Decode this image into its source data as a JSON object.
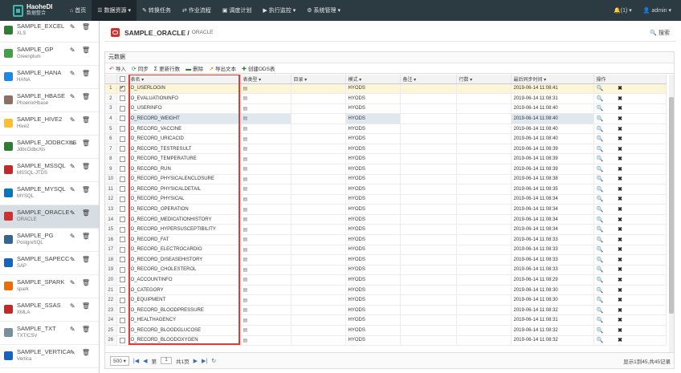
{
  "app": {
    "logo_line1": "HaoheDI",
    "logo_line2": "数据整合"
  },
  "nav": [
    {
      "icon": "⌂",
      "label": "首页"
    },
    {
      "icon": "☰",
      "label": "数据资源 ▾"
    },
    {
      "icon": "✎",
      "label": "转换任务"
    },
    {
      "icon": "⇄",
      "label": "作业流程"
    },
    {
      "icon": "▣",
      "label": "调度计划"
    },
    {
      "icon": "▶",
      "label": "执行监控 ▾"
    },
    {
      "icon": "⚙",
      "label": "系统管理 ▾"
    }
  ],
  "top_right": {
    "notify": "🔔(1) ▾",
    "user": "👤 admin ▾"
  },
  "sidebar": [
    {
      "name": "SAMPLE_EXCEL",
      "sub": "XLS",
      "color": "#2e7d32"
    },
    {
      "name": "SAMPLE_GP",
      "sub": "Greenplum",
      "color": "#43a047"
    },
    {
      "name": "SAMPLE_HANA",
      "sub": "HANA",
      "color": "#1e88e5"
    },
    {
      "name": "SAMPLE_HBASE",
      "sub": "PhoenixHbase",
      "color": "#8d6e63"
    },
    {
      "name": "SAMPLE_HIVE2",
      "sub": "Hive2",
      "color": "#fbc02d"
    },
    {
      "name": "SAMPLE_JODBCXLS",
      "sub": "JdbcOdbcXls",
      "color": "#2e7d32"
    },
    {
      "name": "SAMPLE_MSSQL",
      "sub": "MSSQL-JTDS",
      "color": "#c62828"
    },
    {
      "name": "SAMPLE_MYSQL",
      "sub": "MYSQL",
      "color": "#0277bd"
    },
    {
      "name": "SAMPLE_ORACLE",
      "sub": "ORACLE",
      "color": "#d32f2f"
    },
    {
      "name": "SAMPLE_PG",
      "sub": "PostgreSQL",
      "color": "#336791"
    },
    {
      "name": "SAMPLE_SAPECC",
      "sub": "SAP",
      "color": "#1565c0"
    },
    {
      "name": "SAMPLE_SPARK",
      "sub": "spark",
      "color": "#ef6c00"
    },
    {
      "name": "SAMPLE_SSAS",
      "sub": "XMLA",
      "color": "#c62828"
    },
    {
      "name": "SAMPLE_TXT",
      "sub": "TXT/CSV",
      "color": "#78909c"
    },
    {
      "name": "SAMPLE_VERTICA",
      "sub": "Vertica",
      "color": "#1565c0"
    }
  ],
  "sidebar_actions": "✎ 🗑",
  "header": {
    "title": "SAMPLE_ORACLE /",
    "subtitle": "ORACLE",
    "search": "🔍 搜索"
  },
  "section_title": "元数据",
  "toolbar": [
    {
      "icon": "↶",
      "label": "导入",
      "color": "#d32f2f"
    },
    {
      "icon": "⟳",
      "label": "同步",
      "color": "#2e7d32"
    },
    {
      "icon": "Σ",
      "label": "更新行数",
      "color": "#333"
    },
    {
      "icon": "▬",
      "label": "删除",
      "color": "#2e7d32"
    },
    {
      "icon": "↗",
      "label": "导出文本",
      "color": "#ef6c00"
    },
    {
      "icon": "✚",
      "label": "创建ODS表",
      "color": "#2e7d32"
    }
  ],
  "columns": [
    "",
    "",
    "表名 ▾",
    "表类型 ▾",
    "目录 ▾",
    "模式 ▾",
    "备注 ▾",
    "行数 ▾",
    "最后同步时间 ▾",
    "操作"
  ],
  "type_icon": "▤",
  "op_icons": "🔍 ✖",
  "rows": [
    {
      "n": "1",
      "checked": true,
      "name": "O_USERLOGIN",
      "schema": "HYODS",
      "time": "2019-06-14 11:08:41"
    },
    {
      "n": "2",
      "checked": false,
      "name": "O_EVALUATIONINFO",
      "schema": "HYODS",
      "time": "2019-06-14 11:08:31"
    },
    {
      "n": "3",
      "checked": false,
      "name": "O_USERINFO",
      "schema": "HYODS",
      "time": "2019-06-14 11:08:40"
    },
    {
      "n": "4",
      "checked": false,
      "name": "O_RECORD_WEIGHT",
      "schema": "HYODS",
      "time": "2019-06-14 11:08:40"
    },
    {
      "n": "5",
      "checked": false,
      "name": "O_RECORD_VACCINE",
      "schema": "HYODS",
      "time": "2019-06-14 11:08:40"
    },
    {
      "n": "6",
      "checked": false,
      "name": "O_RECORD_URICACID",
      "schema": "HYODS",
      "time": "2019-06-14 11:08:40"
    },
    {
      "n": "7",
      "checked": false,
      "name": "O_RECORD_TESTRESULT",
      "schema": "HYODS",
      "time": "2019-06-14 11:08:39"
    },
    {
      "n": "8",
      "checked": false,
      "name": "O_RECORD_TEMPERATURE",
      "schema": "HYODS",
      "time": "2019-06-14 11:08:39"
    },
    {
      "n": "9",
      "checked": false,
      "name": "O_RECORD_RUN",
      "schema": "HYODS",
      "time": "2019-06-14 11:08:39"
    },
    {
      "n": "10",
      "checked": false,
      "name": "O_RECORD_PHYSICALENCLOSURE",
      "schema": "HYODS",
      "time": "2019-06-14 11:08:38"
    },
    {
      "n": "11",
      "checked": false,
      "name": "O_RECORD_PHYSICALDETAIL",
      "schema": "HYODS",
      "time": "2019-06-14 11:08:35"
    },
    {
      "n": "12",
      "checked": false,
      "name": "O_RECORD_PHYSICAL",
      "schema": "HYODS",
      "time": "2019-06-14 11:08:34"
    },
    {
      "n": "13",
      "checked": false,
      "name": "O_RECORD_OPERATION",
      "schema": "HYODS",
      "time": "2019-06-14 11:08:34"
    },
    {
      "n": "14",
      "checked": false,
      "name": "O_RECORD_MEDICATIONHISTORY",
      "schema": "HYODS",
      "time": "2019-06-14 11:08:34"
    },
    {
      "n": "15",
      "checked": false,
      "name": "O_RECORD_HYPERSUSCEPTIBILITY",
      "schema": "HYODS",
      "time": "2019-06-14 11:08:34"
    },
    {
      "n": "16",
      "checked": false,
      "name": "O_RECORD_FAT",
      "schema": "HYODS",
      "time": "2019-06-14 11:08:33"
    },
    {
      "n": "17",
      "checked": false,
      "name": "O_RECORD_ELECTROCARDIO",
      "schema": "HYODS",
      "time": "2019-06-14 11:08:33"
    },
    {
      "n": "18",
      "checked": false,
      "name": "O_RECORD_DISEASEHISTORY",
      "schema": "HYODS",
      "time": "2019-06-14 11:08:33"
    },
    {
      "n": "19",
      "checked": false,
      "name": "O_RECORD_CHOLESTEROL",
      "schema": "HYODS",
      "time": "2019-06-14 11:08:33"
    },
    {
      "n": "20",
      "checked": false,
      "name": "O_ACCOUNTINFO",
      "schema": "HYODS",
      "time": "2019-06-14 11:08:29"
    },
    {
      "n": "21",
      "checked": false,
      "name": "O_CATEGORY",
      "schema": "HYODS",
      "time": "2019-06-14 11:08:30"
    },
    {
      "n": "22",
      "checked": false,
      "name": "O_EQUIPMENT",
      "schema": "HYODS",
      "time": "2019-06-14 11:08:30"
    },
    {
      "n": "23",
      "checked": false,
      "name": "O_RECORD_BLOODPRESSURE",
      "schema": "HYODS",
      "time": "2019-06-14 11:08:32"
    },
    {
      "n": "24",
      "checked": false,
      "name": "O_HEALTHAGENCY",
      "schema": "HYODS",
      "time": "2019-06-14 11:08:31"
    },
    {
      "n": "25",
      "checked": false,
      "name": "O_RECORD_BLOODGLUCOSE",
      "schema": "HYODS",
      "time": "2019-06-14 11:08:32"
    },
    {
      "n": "26",
      "checked": false,
      "name": "O_RECORD_BLOODOXYGEN",
      "schema": "HYODS",
      "time": "2019-06-14 11:08:32"
    }
  ],
  "pager": {
    "page_size": "500 ▾",
    "page_label": "第",
    "page_value": "1",
    "total_pages": "共1页",
    "info": "显示1到45,共45记录"
  }
}
